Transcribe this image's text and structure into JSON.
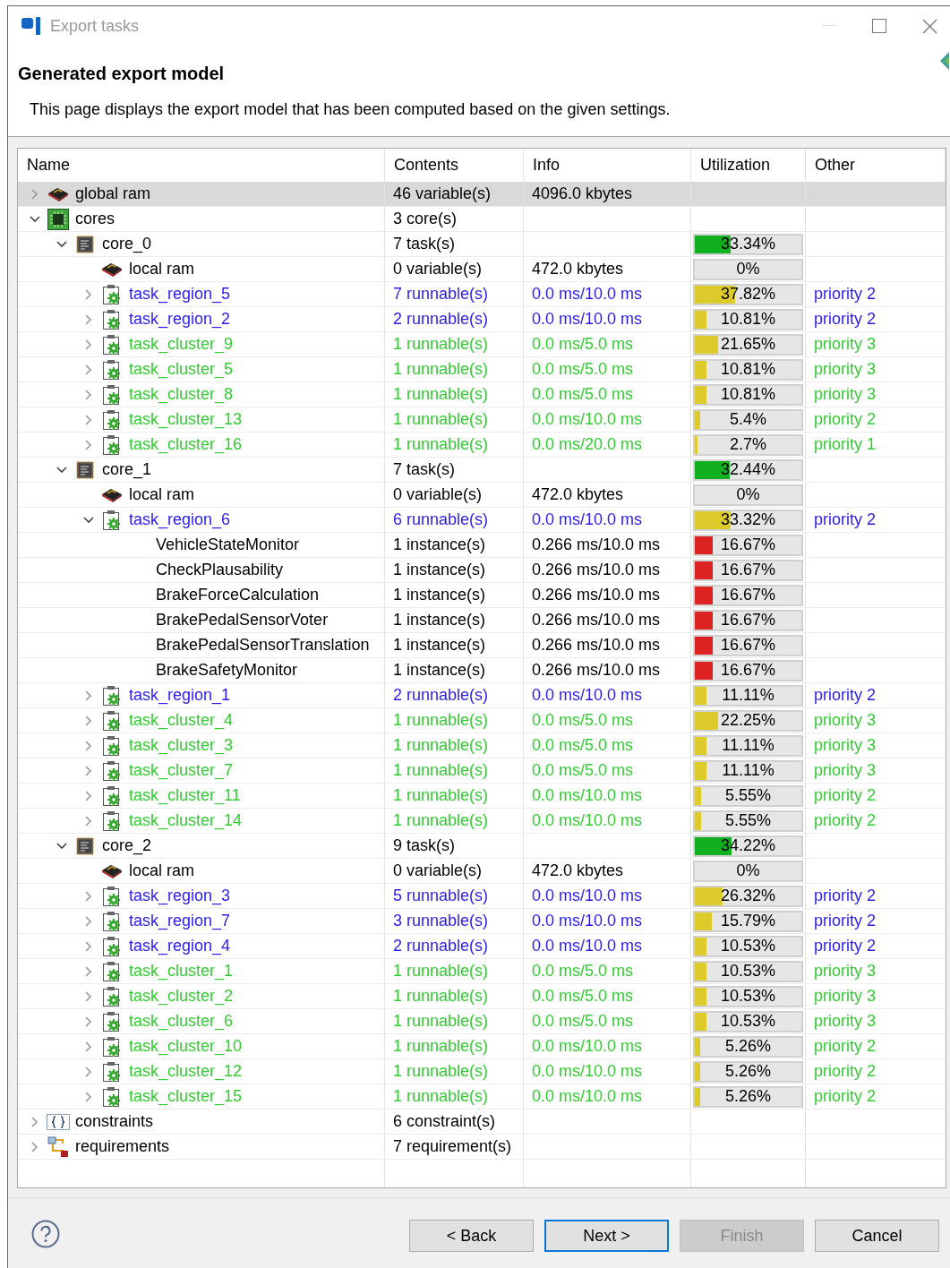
{
  "window": {
    "title": "Export tasks"
  },
  "page": {
    "title": "Generated export model",
    "description": "This page displays the export model that has been computed based on the given settings."
  },
  "table": {
    "columns": [
      "Name",
      "Contents",
      "Info",
      "Utilization",
      "Other"
    ],
    "rows": [
      {
        "kind": "memory",
        "name": "global ram",
        "contents": "46 variable(s)",
        "info": "4096.0 kbytes",
        "expanded": false,
        "selected": true
      },
      {
        "kind": "cores",
        "name": "cores",
        "contents": "3 core(s)",
        "expanded": true,
        "selected": false,
        "children": [
          {
            "kind": "core",
            "name": "core_0",
            "contents": "7 task(s)",
            "util": {
              "text": "33.34%",
              "level": 0.3334,
              "color": "#10b020"
            },
            "expanded": true,
            "selected": false,
            "children": [
              {
                "kind": "memory",
                "name": "local ram",
                "contents": "0 variable(s)",
                "info": "472.0 kbytes",
                "util": {
                  "text": "0%"
                },
                "selected": false
              },
              {
                "kind": "task",
                "name": "task_region_5",
                "contents": "7 runnable(s)",
                "info": "0.0 ms/10.0 ms",
                "util": {
                  "text": "37.82%",
                  "level": 0.3782,
                  "color": "#dccb2a"
                },
                "other": "priority 2",
                "color": "#2a1df0",
                "expanded": false,
                "selected": false
              },
              {
                "kind": "task",
                "name": "task_region_2",
                "contents": "2 runnable(s)",
                "info": "0.0 ms/10.0 ms",
                "util": {
                  "text": "10.81%",
                  "level": 0.1081,
                  "color": "#dccb2a"
                },
                "other": "priority 2",
                "color": "#2a1df0",
                "expanded": false,
                "selected": false
              },
              {
                "kind": "task",
                "name": "task_cluster_9",
                "contents": "1 runnable(s)",
                "info": "0.0 ms/5.0 ms",
                "util": {
                  "text": "21.65%",
                  "level": 0.2165,
                  "color": "#dccb2a"
                },
                "other": "priority 3",
                "color": "#33cc33",
                "expanded": false,
                "selected": false
              },
              {
                "kind": "task",
                "name": "task_cluster_5",
                "contents": "1 runnable(s)",
                "info": "0.0 ms/5.0 ms",
                "util": {
                  "text": "10.81%",
                  "level": 0.1081,
                  "color": "#dccb2a"
                },
                "other": "priority 3",
                "color": "#33cc33",
                "expanded": false,
                "selected": false
              },
              {
                "kind": "task",
                "name": "task_cluster_8",
                "contents": "1 runnable(s)",
                "info": "0.0 ms/5.0 ms",
                "util": {
                  "text": "10.81%",
                  "level": 0.1081,
                  "color": "#dccb2a"
                },
                "other": "priority 3",
                "color": "#33cc33",
                "expanded": false,
                "selected": false
              },
              {
                "kind": "task",
                "name": "task_cluster_13",
                "contents": "1 runnable(s)",
                "info": "0.0 ms/10.0 ms",
                "util": {
                  "text": "5.4%",
                  "level": 0.054,
                  "color": "#dccb2a"
                },
                "other": "priority 2",
                "color": "#33cc33",
                "expanded": false,
                "selected": false
              },
              {
                "kind": "task",
                "name": "task_cluster_16",
                "contents": "1 runnable(s)",
                "info": "0.0 ms/20.0 ms",
                "util": {
                  "text": "2.7%",
                  "level": 0.027,
                  "color": "#dccb2a"
                },
                "other": "priority 1",
                "color": "#33cc33",
                "expanded": false,
                "selected": false
              }
            ]
          },
          {
            "kind": "core",
            "name": "core_1",
            "contents": "7 task(s)",
            "util": {
              "text": "32.44%",
              "level": 0.3244,
              "color": "#10b020"
            },
            "expanded": true,
            "selected": false,
            "children": [
              {
                "kind": "memory",
                "name": "local ram",
                "contents": "0 variable(s)",
                "info": "472.0 kbytes",
                "util": {
                  "text": "0%"
                },
                "selected": false
              },
              {
                "kind": "task",
                "name": "task_region_6",
                "contents": "6 runnable(s)",
                "info": "0.0 ms/10.0 ms",
                "util": {
                  "text": "33.32%",
                  "level": 0.3332,
                  "color": "#dccb2a"
                },
                "other": "priority 2",
                "color": "#2a1df0",
                "expanded": true,
                "selected": false,
                "children": [
                  {
                    "kind": "runnable",
                    "name": "VehicleStateMonitor",
                    "contents": "1 instance(s)",
                    "info": "0.266 ms/10.0 ms",
                    "util": {
                      "text": "16.67%",
                      "level": 0.1667,
                      "color": "#dd2222"
                    },
                    "selected": false
                  },
                  {
                    "kind": "runnable",
                    "name": "CheckPlausability",
                    "contents": "1 instance(s)",
                    "info": "0.266 ms/10.0 ms",
                    "util": {
                      "text": "16.67%",
                      "level": 0.1667,
                      "color": "#dd2222"
                    },
                    "selected": false
                  },
                  {
                    "kind": "runnable",
                    "name": "BrakeForceCalculation",
                    "contents": "1 instance(s)",
                    "info": "0.266 ms/10.0 ms",
                    "util": {
                      "text": "16.67%",
                      "level": 0.1667,
                      "color": "#dd2222"
                    },
                    "selected": false
                  },
                  {
                    "kind": "runnable",
                    "name": "BrakePedalSensorVoter",
                    "contents": "1 instance(s)",
                    "info": "0.266 ms/10.0 ms",
                    "util": {
                      "text": "16.67%",
                      "level": 0.1667,
                      "color": "#dd2222"
                    },
                    "selected": false
                  },
                  {
                    "kind": "runnable",
                    "name": "BrakePedalSensorTranslation",
                    "contents": "1 instance(s)",
                    "info": "0.266 ms/10.0 ms",
                    "util": {
                      "text": "16.67%",
                      "level": 0.1667,
                      "color": "#dd2222"
                    },
                    "selected": false
                  },
                  {
                    "kind": "runnable",
                    "name": "BrakeSafetyMonitor",
                    "contents": "1 instance(s)",
                    "info": "0.266 ms/10.0 ms",
                    "util": {
                      "text": "16.67%",
                      "level": 0.1667,
                      "color": "#dd2222"
                    },
                    "selected": false
                  }
                ]
              },
              {
                "kind": "task",
                "name": "task_region_1",
                "contents": "2 runnable(s)",
                "info": "0.0 ms/10.0 ms",
                "util": {
                  "text": "11.11%",
                  "level": 0.1111,
                  "color": "#dccb2a"
                },
                "other": "priority 2",
                "color": "#2a1df0",
                "expanded": false,
                "selected": false
              },
              {
                "kind": "task",
                "name": "task_cluster_4",
                "contents": "1 runnable(s)",
                "info": "0.0 ms/5.0 ms",
                "util": {
                  "text": "22.25%",
                  "level": 0.2225,
                  "color": "#dccb2a"
                },
                "other": "priority 3",
                "color": "#33cc33",
                "expanded": false,
                "selected": false
              },
              {
                "kind": "task",
                "name": "task_cluster_3",
                "contents": "1 runnable(s)",
                "info": "0.0 ms/5.0 ms",
                "util": {
                  "text": "11.11%",
                  "level": 0.1111,
                  "color": "#dccb2a"
                },
                "other": "priority 3",
                "color": "#33cc33",
                "expanded": false,
                "selected": false
              },
              {
                "kind": "task",
                "name": "task_cluster_7",
                "contents": "1 runnable(s)",
                "info": "0.0 ms/5.0 ms",
                "util": {
                  "text": "11.11%",
                  "level": 0.1111,
                  "color": "#dccb2a"
                },
                "other": "priority 3",
                "color": "#33cc33",
                "expanded": false,
                "selected": false
              },
              {
                "kind": "task",
                "name": "task_cluster_11",
                "contents": "1 runnable(s)",
                "info": "0.0 ms/10.0 ms",
                "util": {
                  "text": "5.55%",
                  "level": 0.0555,
                  "color": "#dccb2a"
                },
                "other": "priority 2",
                "color": "#33cc33",
                "expanded": false,
                "selected": false
              },
              {
                "kind": "task",
                "name": "task_cluster_14",
                "contents": "1 runnable(s)",
                "info": "0.0 ms/10.0 ms",
                "util": {
                  "text": "5.55%",
                  "level": 0.0555,
                  "color": "#dccb2a"
                },
                "other": "priority 2",
                "color": "#33cc33",
                "expanded": false,
                "selected": false
              }
            ]
          },
          {
            "kind": "core",
            "name": "core_2",
            "contents": "9 task(s)",
            "util": {
              "text": "34.22%",
              "level": 0.3422,
              "color": "#10b020"
            },
            "expanded": true,
            "selected": false,
            "children": [
              {
                "kind": "memory",
                "name": "local ram",
                "contents": "0 variable(s)",
                "info": "472.0 kbytes",
                "util": {
                  "text": "0%"
                },
                "selected": false
              },
              {
                "kind": "task",
                "name": "task_region_3",
                "contents": "5 runnable(s)",
                "info": "0.0 ms/10.0 ms",
                "util": {
                  "text": "26.32%",
                  "level": 0.2632,
                  "color": "#dccb2a"
                },
                "other": "priority 2",
                "color": "#2a1df0",
                "expanded": false,
                "selected": false
              },
              {
                "kind": "task",
                "name": "task_region_7",
                "contents": "3 runnable(s)",
                "info": "0.0 ms/10.0 ms",
                "util": {
                  "text": "15.79%",
                  "level": 0.1579,
                  "color": "#dccb2a"
                },
                "other": "priority 2",
                "color": "#2a1df0",
                "expanded": false,
                "selected": false
              },
              {
                "kind": "task",
                "name": "task_region_4",
                "contents": "2 runnable(s)",
                "info": "0.0 ms/10.0 ms",
                "util": {
                  "text": "10.53%",
                  "level": 0.1053,
                  "color": "#dccb2a"
                },
                "other": "priority 2",
                "color": "#2a1df0",
                "expanded": false,
                "selected": false
              },
              {
                "kind": "task",
                "name": "task_cluster_1",
                "contents": "1 runnable(s)",
                "info": "0.0 ms/5.0 ms",
                "util": {
                  "text": "10.53%",
                  "level": 0.1053,
                  "color": "#dccb2a"
                },
                "other": "priority 3",
                "color": "#33cc33",
                "expanded": false,
                "selected": false
              },
              {
                "kind": "task",
                "name": "task_cluster_2",
                "contents": "1 runnable(s)",
                "info": "0.0 ms/5.0 ms",
                "util": {
                  "text": "10.53%",
                  "level": 0.1053,
                  "color": "#dccb2a"
                },
                "other": "priority 3",
                "color": "#33cc33",
                "expanded": false,
                "selected": false
              },
              {
                "kind": "task",
                "name": "task_cluster_6",
                "contents": "1 runnable(s)",
                "info": "0.0 ms/5.0 ms",
                "util": {
                  "text": "10.53%",
                  "level": 0.1053,
                  "color": "#dccb2a"
                },
                "other": "priority 3",
                "color": "#33cc33",
                "expanded": false,
                "selected": false
              },
              {
                "kind": "task",
                "name": "task_cluster_10",
                "contents": "1 runnable(s)",
                "info": "0.0 ms/10.0 ms",
                "util": {
                  "text": "5.26%",
                  "level": 0.0526,
                  "color": "#dccb2a"
                },
                "other": "priority 2",
                "color": "#33cc33",
                "expanded": false,
                "selected": false
              },
              {
                "kind": "task",
                "name": "task_cluster_12",
                "contents": "1 runnable(s)",
                "info": "0.0 ms/10.0 ms",
                "util": {
                  "text": "5.26%",
                  "level": 0.0526,
                  "color": "#dccb2a"
                },
                "other": "priority 2",
                "color": "#33cc33",
                "expanded": false,
                "selected": false
              },
              {
                "kind": "task",
                "name": "task_cluster_15",
                "contents": "1 runnable(s)",
                "info": "0.0 ms/10.0 ms",
                "util": {
                  "text": "5.26%",
                  "level": 0.0526,
                  "color": "#dccb2a"
                },
                "other": "priority 2",
                "color": "#33cc33",
                "expanded": false,
                "selected": false
              }
            ]
          }
        ]
      },
      {
        "kind": "constraints",
        "name": "constraints",
        "contents": "6 constraint(s)",
        "expanded": false,
        "selected": false
      },
      {
        "kind": "requirements",
        "name": "requirements",
        "contents": "7 requirement(s)",
        "expanded": false,
        "selected": false
      }
    ]
  },
  "buttons": [
    {
      "label": "< Back",
      "disabled": false,
      "focused": false
    },
    {
      "label": "Next >",
      "disabled": false,
      "focused": true
    },
    {
      "label": "Finish",
      "disabled": true,
      "focused": false
    },
    {
      "label": "Cancel",
      "disabled": false,
      "focused": false
    }
  ]
}
